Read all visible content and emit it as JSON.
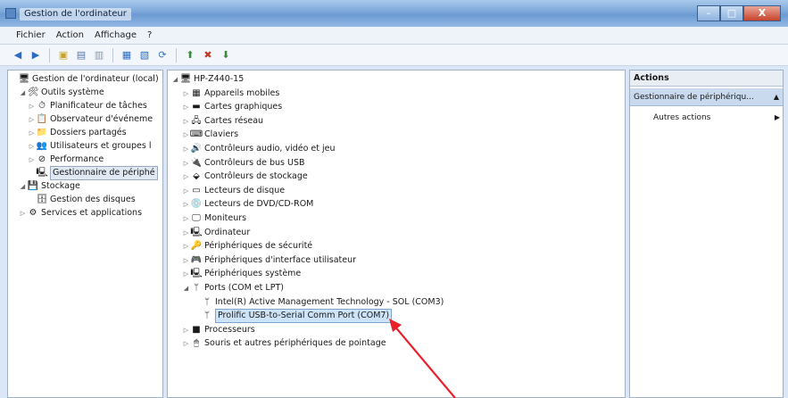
{
  "window": {
    "title": "Gestion de l'ordinateur",
    "minimize": "–",
    "maximize": "□",
    "close": "X"
  },
  "menu": [
    "Fichier",
    "Action",
    "Affichage",
    "?"
  ],
  "left_tree": [
    {
      "label": "Gestion de l'ordinateur (local)",
      "icon": "computer-management-icon",
      "glyph": "🖥",
      "expander": "",
      "level": 0
    },
    {
      "label": "Outils système",
      "icon": "tools-icon",
      "glyph": "🛠",
      "expander": "◢",
      "level": 1
    },
    {
      "label": "Planificateur de tâches",
      "icon": "clock-icon",
      "glyph": "⏱",
      "expander": "▷",
      "level": 2
    },
    {
      "label": "Observateur d'événeme",
      "icon": "event-viewer-icon",
      "glyph": "📋",
      "expander": "▷",
      "level": 2
    },
    {
      "label": "Dossiers partagés",
      "icon": "shared-folder-icon",
      "glyph": "📁",
      "expander": "▷",
      "level": 2
    },
    {
      "label": "Utilisateurs et groupes l",
      "icon": "users-icon",
      "glyph": "👥",
      "expander": "▷",
      "level": 2
    },
    {
      "label": "Performance",
      "icon": "performance-icon",
      "glyph": "⊘",
      "expander": "▷",
      "level": 2
    },
    {
      "label": "Gestionnaire de périphé",
      "icon": "device-manager-icon",
      "glyph": "🖳",
      "expander": "",
      "level": 2,
      "selected": true
    },
    {
      "label": "Stockage",
      "icon": "storage-icon",
      "glyph": "💾",
      "expander": "◢",
      "level": 1
    },
    {
      "label": "Gestion des disques",
      "icon": "disk-icon",
      "glyph": "🗄",
      "expander": "",
      "level": 2
    },
    {
      "label": "Services et applications",
      "icon": "services-icon",
      "glyph": "⚙",
      "expander": "▷",
      "level": 1
    }
  ],
  "device_tree": [
    {
      "label": "HP-Z440-15",
      "icon": "computer-icon",
      "glyph": "🖥",
      "expander": "◢",
      "level": 0
    },
    {
      "label": "Appareils mobiles",
      "icon": "mobile-device-icon",
      "glyph": "▦",
      "expander": "▷",
      "level": 1
    },
    {
      "label": "Cartes graphiques",
      "icon": "graphics-card-icon",
      "glyph": "▬",
      "expander": "▷",
      "level": 1
    },
    {
      "label": "Cartes réseau",
      "icon": "network-card-icon",
      "glyph": "🖧",
      "expander": "▷",
      "level": 1
    },
    {
      "label": "Claviers",
      "icon": "keyboard-icon",
      "glyph": "⌨",
      "expander": "▷",
      "level": 1
    },
    {
      "label": "Contrôleurs audio, vidéo et jeu",
      "icon": "audio-icon",
      "glyph": "🔊",
      "expander": "▷",
      "level": 1
    },
    {
      "label": "Contrôleurs de bus USB",
      "icon": "usb-icon",
      "glyph": "🔌",
      "expander": "▷",
      "level": 1
    },
    {
      "label": "Contrôleurs de stockage",
      "icon": "storage-controller-icon",
      "glyph": "⬙",
      "expander": "▷",
      "level": 1
    },
    {
      "label": "Lecteurs de disque",
      "icon": "disk-drive-icon",
      "glyph": "▭",
      "expander": "▷",
      "level": 1
    },
    {
      "label": "Lecteurs de DVD/CD-ROM",
      "icon": "dvd-icon",
      "glyph": "💿",
      "expander": "▷",
      "level": 1
    },
    {
      "label": "Moniteurs",
      "icon": "monitor-icon",
      "glyph": "🖵",
      "expander": "▷",
      "level": 1
    },
    {
      "label": "Ordinateur",
      "icon": "computer-small-icon",
      "glyph": "🖳",
      "expander": "▷",
      "level": 1
    },
    {
      "label": "Périphériques de sécurité",
      "icon": "security-key-icon",
      "glyph": "🔑",
      "expander": "▷",
      "level": 1
    },
    {
      "label": "Périphériques d'interface utilisateur",
      "icon": "hid-icon",
      "glyph": "🎮",
      "expander": "▷",
      "level": 1
    },
    {
      "label": "Périphériques système",
      "icon": "system-device-icon",
      "glyph": "🖳",
      "expander": "▷",
      "level": 1
    },
    {
      "label": "Ports (COM et LPT)",
      "icon": "port-icon",
      "glyph": "ᛘ",
      "expander": "◢",
      "level": 1
    },
    {
      "label": "Intel(R) Active Management Technology - SOL (COM3)",
      "icon": "port-icon",
      "glyph": "ᛘ",
      "expander": "",
      "level": 2
    },
    {
      "label": "Prolific USB-to-Serial Comm Port (COM7)",
      "icon": "port-icon",
      "glyph": "ᛘ",
      "expander": "",
      "level": 2,
      "highlight": true
    },
    {
      "label": "Processeurs",
      "icon": "processor-icon",
      "glyph": "■",
      "expander": "▷",
      "level": 1
    },
    {
      "label": "Souris et autres périphériques de pointage",
      "icon": "mouse-icon",
      "glyph": "🖱",
      "expander": "▷",
      "level": 1
    }
  ],
  "actions": {
    "header": "Actions",
    "section": "Gestionnaire de périphériqu...",
    "section_toggle": "▲",
    "item": "Autres actions",
    "item_arrow": "▶"
  },
  "colors": {
    "annotation_arrow": "#e8202a"
  }
}
